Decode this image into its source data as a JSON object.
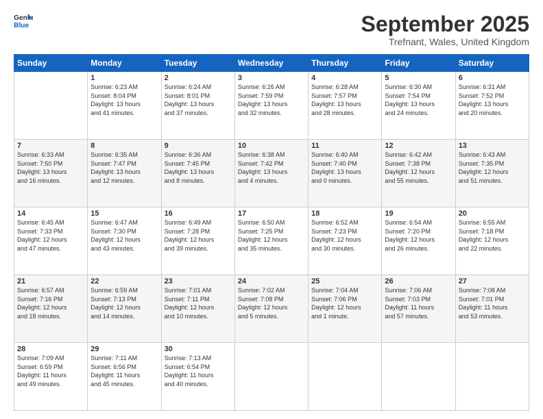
{
  "logo": {
    "line1": "General",
    "line2": "Blue"
  },
  "title": "September 2025",
  "subtitle": "Trefnant, Wales, United Kingdom",
  "header_days": [
    "Sunday",
    "Monday",
    "Tuesday",
    "Wednesday",
    "Thursday",
    "Friday",
    "Saturday"
  ],
  "weeks": [
    [
      {
        "num": "",
        "detail": ""
      },
      {
        "num": "1",
        "detail": "Sunrise: 6:23 AM\nSunset: 8:04 PM\nDaylight: 13 hours\nand 41 minutes."
      },
      {
        "num": "2",
        "detail": "Sunrise: 6:24 AM\nSunset: 8:01 PM\nDaylight: 13 hours\nand 37 minutes."
      },
      {
        "num": "3",
        "detail": "Sunrise: 6:26 AM\nSunset: 7:59 PM\nDaylight: 13 hours\nand 32 minutes."
      },
      {
        "num": "4",
        "detail": "Sunrise: 6:28 AM\nSunset: 7:57 PM\nDaylight: 13 hours\nand 28 minutes."
      },
      {
        "num": "5",
        "detail": "Sunrise: 6:30 AM\nSunset: 7:54 PM\nDaylight: 13 hours\nand 24 minutes."
      },
      {
        "num": "6",
        "detail": "Sunrise: 6:31 AM\nSunset: 7:52 PM\nDaylight: 13 hours\nand 20 minutes."
      }
    ],
    [
      {
        "num": "7",
        "detail": "Sunrise: 6:33 AM\nSunset: 7:50 PM\nDaylight: 13 hours\nand 16 minutes."
      },
      {
        "num": "8",
        "detail": "Sunrise: 6:35 AM\nSunset: 7:47 PM\nDaylight: 13 hours\nand 12 minutes."
      },
      {
        "num": "9",
        "detail": "Sunrise: 6:36 AM\nSunset: 7:45 PM\nDaylight: 13 hours\nand 8 minutes."
      },
      {
        "num": "10",
        "detail": "Sunrise: 6:38 AM\nSunset: 7:42 PM\nDaylight: 13 hours\nand 4 minutes."
      },
      {
        "num": "11",
        "detail": "Sunrise: 6:40 AM\nSunset: 7:40 PM\nDaylight: 13 hours\nand 0 minutes."
      },
      {
        "num": "12",
        "detail": "Sunrise: 6:42 AM\nSunset: 7:38 PM\nDaylight: 12 hours\nand 55 minutes."
      },
      {
        "num": "13",
        "detail": "Sunrise: 6:43 AM\nSunset: 7:35 PM\nDaylight: 12 hours\nand 51 minutes."
      }
    ],
    [
      {
        "num": "14",
        "detail": "Sunrise: 6:45 AM\nSunset: 7:33 PM\nDaylight: 12 hours\nand 47 minutes."
      },
      {
        "num": "15",
        "detail": "Sunrise: 6:47 AM\nSunset: 7:30 PM\nDaylight: 12 hours\nand 43 minutes."
      },
      {
        "num": "16",
        "detail": "Sunrise: 6:49 AM\nSunset: 7:28 PM\nDaylight: 12 hours\nand 39 minutes."
      },
      {
        "num": "17",
        "detail": "Sunrise: 6:50 AM\nSunset: 7:25 PM\nDaylight: 12 hours\nand 35 minutes."
      },
      {
        "num": "18",
        "detail": "Sunrise: 6:52 AM\nSunset: 7:23 PM\nDaylight: 12 hours\nand 30 minutes."
      },
      {
        "num": "19",
        "detail": "Sunrise: 6:54 AM\nSunset: 7:20 PM\nDaylight: 12 hours\nand 26 minutes."
      },
      {
        "num": "20",
        "detail": "Sunrise: 6:55 AM\nSunset: 7:18 PM\nDaylight: 12 hours\nand 22 minutes."
      }
    ],
    [
      {
        "num": "21",
        "detail": "Sunrise: 6:57 AM\nSunset: 7:16 PM\nDaylight: 12 hours\nand 18 minutes."
      },
      {
        "num": "22",
        "detail": "Sunrise: 6:59 AM\nSunset: 7:13 PM\nDaylight: 12 hours\nand 14 minutes."
      },
      {
        "num": "23",
        "detail": "Sunrise: 7:01 AM\nSunset: 7:11 PM\nDaylight: 12 hours\nand 10 minutes."
      },
      {
        "num": "24",
        "detail": "Sunrise: 7:02 AM\nSunset: 7:08 PM\nDaylight: 12 hours\nand 5 minutes."
      },
      {
        "num": "25",
        "detail": "Sunrise: 7:04 AM\nSunset: 7:06 PM\nDaylight: 12 hours\nand 1 minute."
      },
      {
        "num": "26",
        "detail": "Sunrise: 7:06 AM\nSunset: 7:03 PM\nDaylight: 11 hours\nand 57 minutes."
      },
      {
        "num": "27",
        "detail": "Sunrise: 7:08 AM\nSunset: 7:01 PM\nDaylight: 11 hours\nand 53 minutes."
      }
    ],
    [
      {
        "num": "28",
        "detail": "Sunrise: 7:09 AM\nSunset: 6:59 PM\nDaylight: 11 hours\nand 49 minutes."
      },
      {
        "num": "29",
        "detail": "Sunrise: 7:11 AM\nSunset: 6:56 PM\nDaylight: 11 hours\nand 45 minutes."
      },
      {
        "num": "30",
        "detail": "Sunrise: 7:13 AM\nSunset: 6:54 PM\nDaylight: 11 hours\nand 40 minutes."
      },
      {
        "num": "",
        "detail": ""
      },
      {
        "num": "",
        "detail": ""
      },
      {
        "num": "",
        "detail": ""
      },
      {
        "num": "",
        "detail": ""
      }
    ]
  ]
}
